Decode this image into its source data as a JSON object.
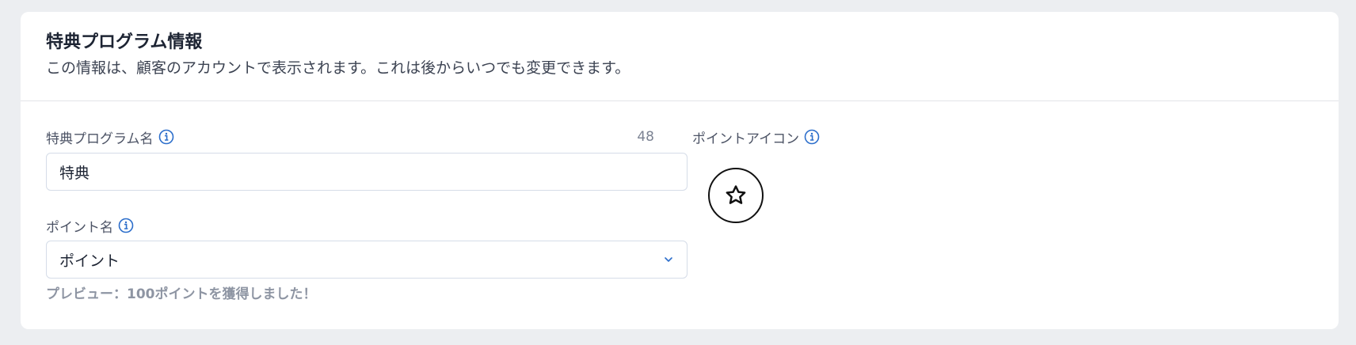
{
  "section": {
    "title": "特典プログラム情報",
    "description": "この情報は、顧客のアカウントで表示されます。これは後からいつでも変更できます。"
  },
  "program_name": {
    "label": "特典プログラム名",
    "value": "特典",
    "remaining_chars": "48"
  },
  "points_name": {
    "label": "ポイント名",
    "selected": "ポイント",
    "preview": "プレビュー：100ポイントを獲得しました！"
  },
  "points_icon": {
    "label": "ポイントアイコン",
    "icon": "star-icon"
  },
  "colors": {
    "accent": "#2c6ecb",
    "background": "#eceef1",
    "card": "#ffffff",
    "border": "#d5dce8"
  }
}
